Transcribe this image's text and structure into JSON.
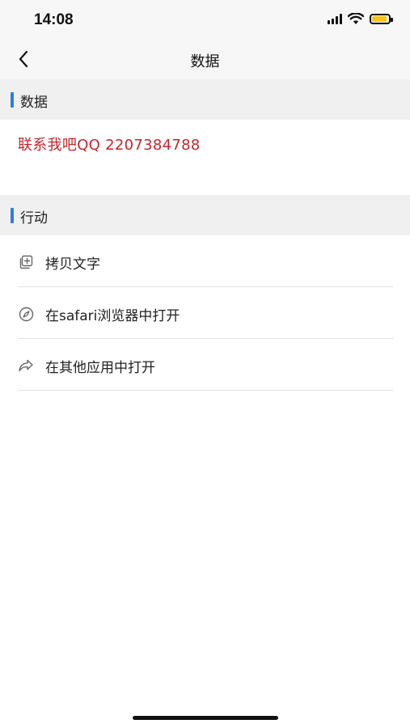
{
  "status_bar": {
    "time": "14:08",
    "battery_color": "#f5c518"
  },
  "nav": {
    "title": "数据",
    "back_icon": "chevron-left-icon"
  },
  "sections": {
    "data": {
      "title": "数据",
      "accent_color": "#2f7bea"
    },
    "actions": {
      "title": "行动",
      "accent_color": "#2f7bea"
    }
  },
  "data_content": {
    "text": "联系我吧QQ 2207384788",
    "color": "#c0272d"
  },
  "actions": [
    {
      "label": "拷贝文字",
      "icon": "copy-icon"
    },
    {
      "label": "在safari浏览器中打开",
      "icon": "compass-icon"
    },
    {
      "label": "在其他应用中打开",
      "icon": "share-arrow-icon"
    }
  ]
}
